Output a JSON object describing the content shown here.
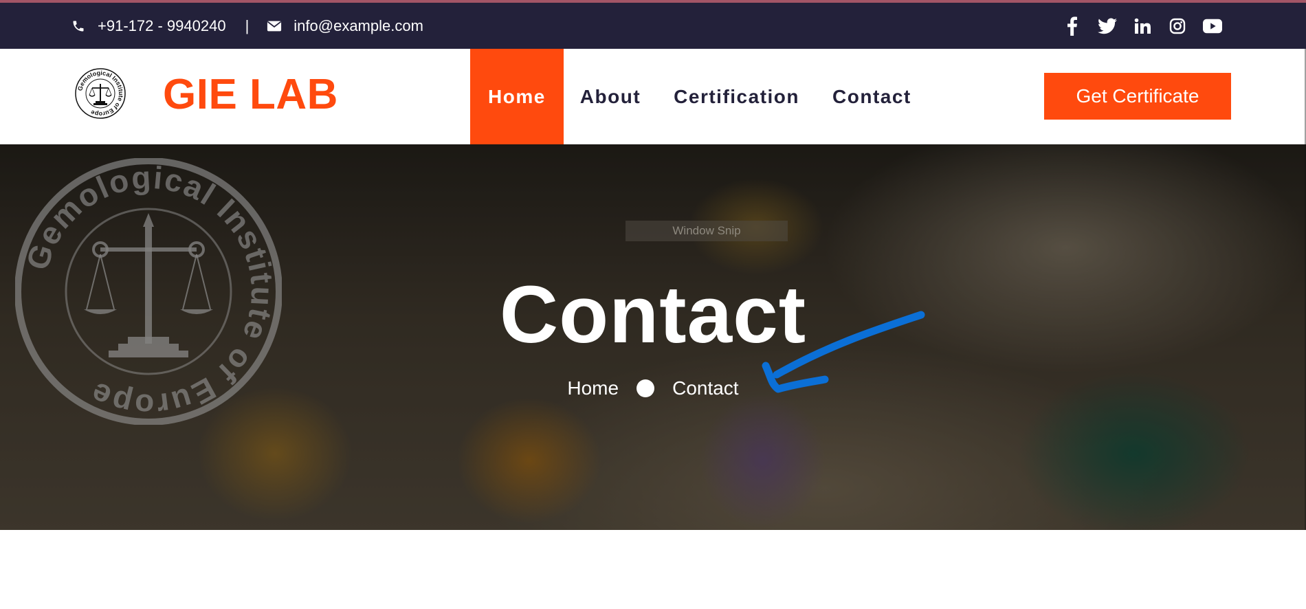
{
  "topbar": {
    "phone": "+91-172 - 9940240",
    "separator": "|",
    "email": "info@example.com",
    "social_icons": [
      "facebook-icon",
      "twitter-icon",
      "linkedin-icon",
      "instagram-icon",
      "youtube-icon"
    ]
  },
  "header": {
    "brand": "GIE LAB",
    "emblem_text": "Gemological Institute of Europe",
    "nav": [
      {
        "label": "Home",
        "active": true
      },
      {
        "label": "About",
        "active": false
      },
      {
        "label": "Certification",
        "active": false
      },
      {
        "label": "Contact",
        "active": false
      }
    ],
    "cta_label": "Get Certificate"
  },
  "hero": {
    "snip_label": "Window Snip",
    "title": "Contact",
    "breadcrumb": {
      "home": "Home",
      "current": "Contact"
    },
    "seal_text": "Gemological Institute of Europe"
  },
  "colors": {
    "accent": "#ff4a0e",
    "dark": "#23213a",
    "annotation": "#0b6fd6"
  }
}
